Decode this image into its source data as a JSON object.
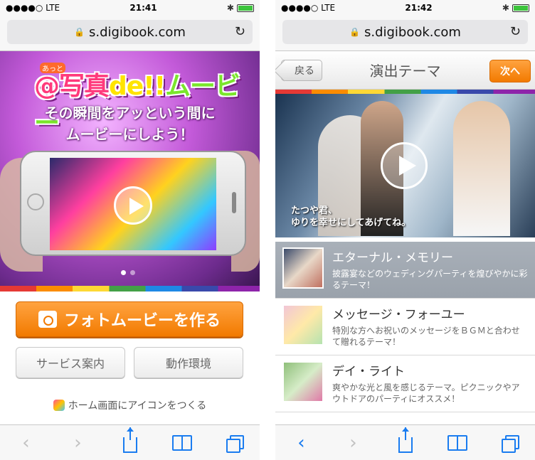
{
  "status_left": {
    "signal": "●●●●○ LTE",
    "time": "21:41"
  },
  "status_right": {
    "signal": "●●●●○ LTE",
    "time": "21:42"
  },
  "browser": {
    "url": "s.digibook.com",
    "lock": "🔒",
    "reload": "↻"
  },
  "left": {
    "logo_small": "あっと",
    "logo_at": "@写真",
    "logo_de": "de!!",
    "logo_movie": "ムービー",
    "tagline_line1": "その瞬間をアッという間に",
    "tagline_line2": "ムービーにしよう！",
    "make_button": "フォトムービーを作る",
    "service_button": "サービス案内",
    "env_button": "動作環境",
    "home_icon_link": "ホーム画面にアイコンをつくる"
  },
  "right": {
    "back": "戻る",
    "title": "演出テーマ",
    "next": "次へ",
    "caption_line1": "たつや君、",
    "caption_line2": "ゆりを幸せにしてあげてね。",
    "themes": [
      {
        "name": "エターナル・メモリー",
        "desc": "披露宴などのウェディングパーティを煌びやかに彩るテーマ！"
      },
      {
        "name": "メッセージ・フォーユー",
        "desc": "特別な方へお祝いのメッセージをＢＧＭと合わせて贈れるテーマ！"
      },
      {
        "name": "デイ・ライト",
        "desc": "爽やかな光と風を感じるテーマ。ピクニックやアウトドアのパーティにオススメ！"
      }
    ]
  },
  "toolbar": {
    "back": "‹",
    "forward": "›"
  },
  "colors": {
    "orange": "#f27a00",
    "ios_blue": "#1a7cf0",
    "battery_green": "#3cc43c"
  }
}
